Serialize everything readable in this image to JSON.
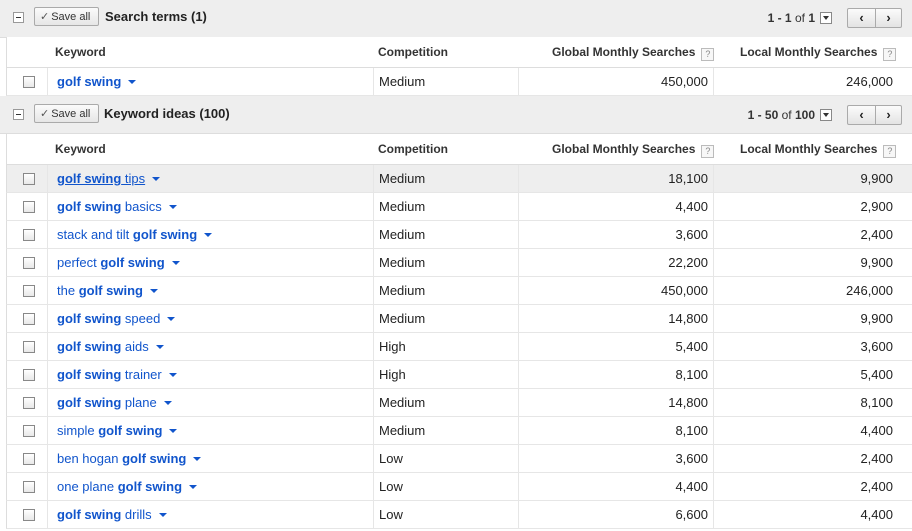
{
  "search_terms": {
    "save_all": "Save all",
    "title": "Search terms (1)",
    "pager": {
      "range": "1 - 1",
      "of": "of",
      "total": "1"
    }
  },
  "keyword_ideas": {
    "save_all": "Save all",
    "title": "Keyword ideas (100)",
    "pager": {
      "range": "1 - 50",
      "of": "of",
      "total": "100"
    }
  },
  "columns": {
    "keyword": "Keyword",
    "competition": "Competition",
    "global": "Global Monthly Searches",
    "local": "Local Monthly Searches",
    "help": "?"
  },
  "nav": {
    "prev": "‹",
    "next": "›"
  },
  "search_rows": [
    {
      "pre": "",
      "bold": "golf swing",
      "post": "",
      "competition": "Medium",
      "global": "450,000",
      "local": "246,000"
    }
  ],
  "idea_rows": [
    {
      "pre": "",
      "bold": "golf swing",
      "post": " tips",
      "competition": "Medium",
      "global": "18,100",
      "local": "9,900"
    },
    {
      "pre": "",
      "bold": "golf swing",
      "post": " basics",
      "competition": "Medium",
      "global": "4,400",
      "local": "2,900"
    },
    {
      "pre": "stack and tilt ",
      "bold": "golf swing",
      "post": "",
      "competition": "Medium",
      "global": "3,600",
      "local": "2,400"
    },
    {
      "pre": "perfect ",
      "bold": "golf swing",
      "post": "",
      "competition": "Medium",
      "global": "22,200",
      "local": "9,900"
    },
    {
      "pre": "the ",
      "bold": "golf swing",
      "post": "",
      "competition": "Medium",
      "global": "450,000",
      "local": "246,000"
    },
    {
      "pre": "",
      "bold": "golf swing",
      "post": " speed",
      "competition": "Medium",
      "global": "14,800",
      "local": "9,900"
    },
    {
      "pre": "",
      "bold": "golf swing",
      "post": " aids",
      "competition": "High",
      "global": "5,400",
      "local": "3,600"
    },
    {
      "pre": "",
      "bold": "golf swing",
      "post": " trainer",
      "competition": "High",
      "global": "8,100",
      "local": "5,400"
    },
    {
      "pre": "",
      "bold": "golf swing",
      "post": " plane",
      "competition": "Medium",
      "global": "14,800",
      "local": "8,100"
    },
    {
      "pre": "simple ",
      "bold": "golf swing",
      "post": "",
      "competition": "Medium",
      "global": "8,100",
      "local": "4,400"
    },
    {
      "pre": "ben hogan ",
      "bold": "golf swing",
      "post": "",
      "competition": "Low",
      "global": "3,600",
      "local": "2,400"
    },
    {
      "pre": "one plane ",
      "bold": "golf swing",
      "post": "",
      "competition": "Low",
      "global": "4,400",
      "local": "2,400"
    },
    {
      "pre": "",
      "bold": "golf swing",
      "post": " drills",
      "competition": "Low",
      "global": "6,600",
      "local": "4,400"
    }
  ]
}
